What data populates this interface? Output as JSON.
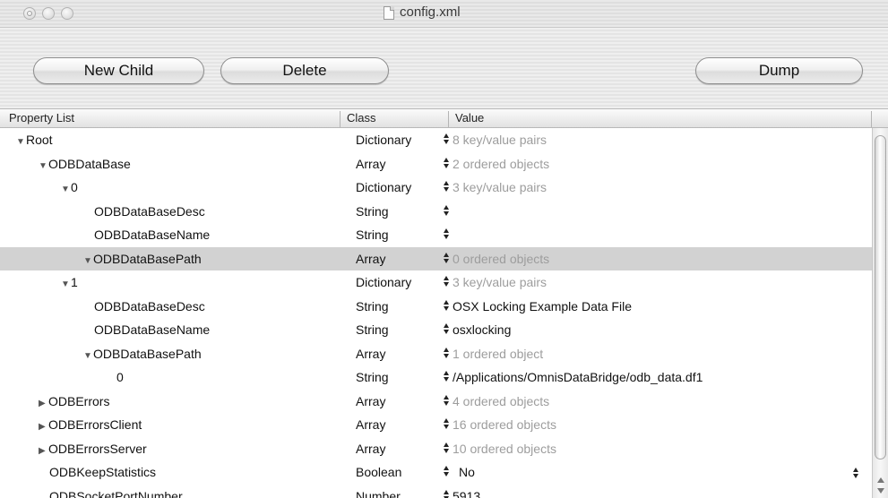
{
  "window": {
    "title": "config.xml"
  },
  "toolbar": {
    "new_child_label": "New Child",
    "delete_label": "Delete",
    "dump_label": "Dump"
  },
  "columns": {
    "property": "Property List",
    "class": "Class",
    "value": "Value"
  },
  "rows": [
    {
      "name": "Root",
      "level": 0,
      "disclosure": "expanded",
      "class": "Dictionary",
      "value": "8 key/value pairs",
      "dim": true
    },
    {
      "name": "ODBDataBase",
      "level": 1,
      "disclosure": "expanded",
      "class": "Array",
      "value": "2 ordered objects",
      "dim": true
    },
    {
      "name": "0",
      "level": 2,
      "disclosure": "expanded",
      "class": "Dictionary",
      "value": "3 key/value pairs",
      "dim": true
    },
    {
      "name": "ODBDataBaseDesc",
      "level": 3,
      "disclosure": "none",
      "class": "String",
      "value": "",
      "dim": false
    },
    {
      "name": "ODBDataBaseName",
      "level": 3,
      "disclosure": "none",
      "class": "String",
      "value": "",
      "dim": false
    },
    {
      "name": "ODBDataBasePath",
      "level": 3,
      "disclosure": "expanded",
      "class": "Array",
      "value": "0 ordered objects",
      "dim": true,
      "selected": true
    },
    {
      "name": "1",
      "level": 2,
      "disclosure": "expanded",
      "class": "Dictionary",
      "value": "3 key/value pairs",
      "dim": true
    },
    {
      "name": "ODBDataBaseDesc",
      "level": 3,
      "disclosure": "none",
      "class": "String",
      "value": "OSX Locking Example Data File",
      "dim": false
    },
    {
      "name": "ODBDataBaseName",
      "level": 3,
      "disclosure": "none",
      "class": "String",
      "value": "osxlocking",
      "dim": false
    },
    {
      "name": "ODBDataBasePath",
      "level": 3,
      "disclosure": "expanded",
      "class": "Array",
      "value": "1 ordered object",
      "dim": true
    },
    {
      "name": "0",
      "level": 4,
      "disclosure": "none",
      "class": "String",
      "value": "/Applications/OmnisDataBridge/odb_data.df1",
      "dim": false
    },
    {
      "name": "ODBErrors",
      "level": 1,
      "disclosure": "collapsed",
      "class": "Array",
      "value": "4 ordered objects",
      "dim": true
    },
    {
      "name": "ODBErrorsClient",
      "level": 1,
      "disclosure": "collapsed",
      "class": "Array",
      "value": "16 ordered objects",
      "dim": true
    },
    {
      "name": "ODBErrorsServer",
      "level": 1,
      "disclosure": "collapsed",
      "class": "Array",
      "value": "10 ordered objects",
      "dim": true
    },
    {
      "name": "ODBKeepStatistics",
      "level": 1,
      "disclosure": "none",
      "class": "Boolean",
      "value": "No",
      "dim": false,
      "value_popup": true
    },
    {
      "name": "ODBSocketPortNumber",
      "level": 1,
      "disclosure": "none",
      "class": "Number",
      "value": "5913",
      "dim": false
    }
  ]
}
